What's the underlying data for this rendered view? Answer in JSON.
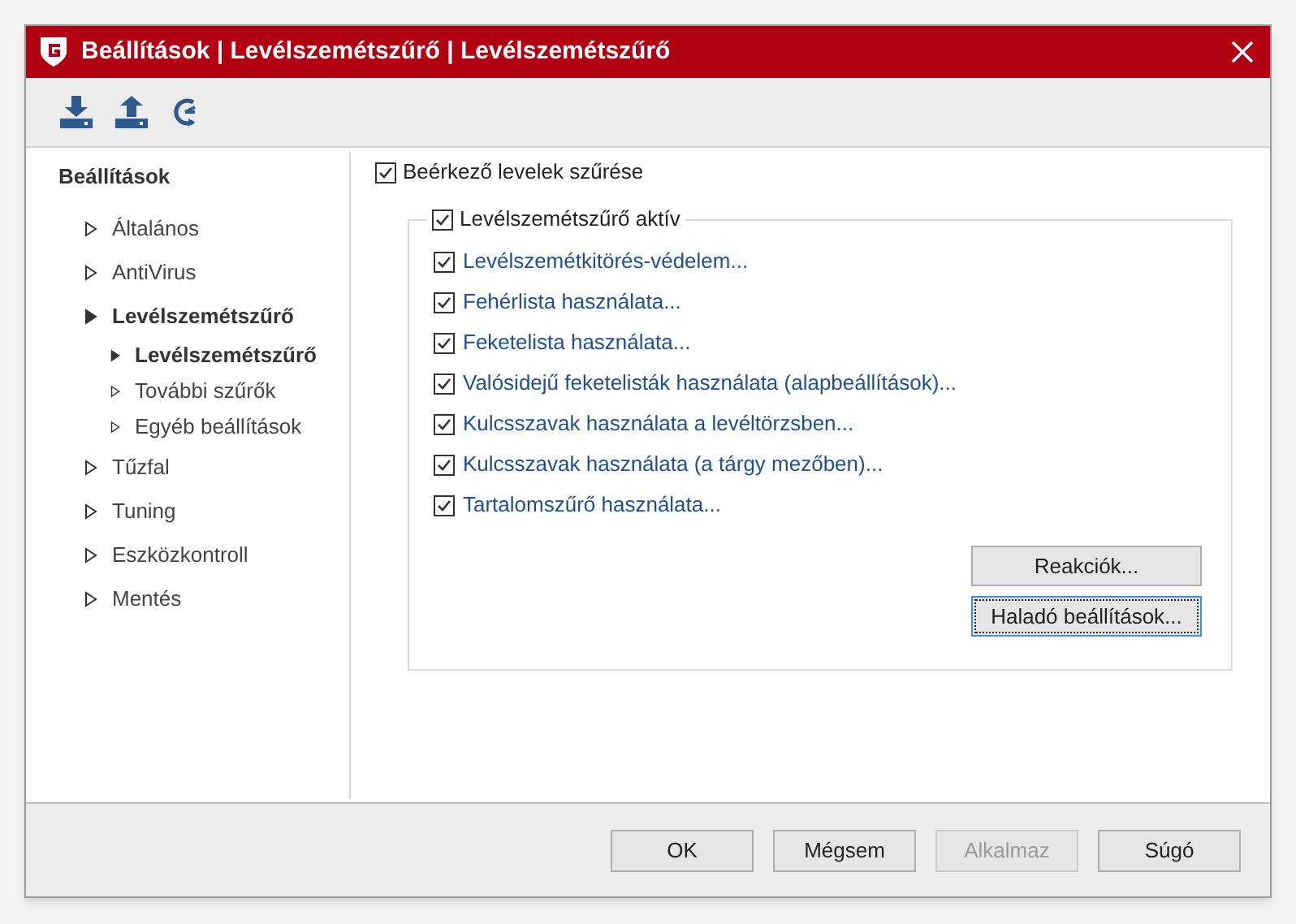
{
  "window": {
    "title": "Beállítások | Levélszemétszűrő | Levélszemétszűrő"
  },
  "sidebar": {
    "heading": "Beállítások",
    "items": [
      {
        "label": "Általános",
        "expanded": false
      },
      {
        "label": "AntiVirus",
        "expanded": false
      },
      {
        "label": "Levélszemétszűrő",
        "expanded": true,
        "children": [
          {
            "label": "Levélszemétszűrő",
            "selected": true
          },
          {
            "label": "További szűrők",
            "selected": false
          },
          {
            "label": "Egyéb beállítások",
            "selected": false
          }
        ]
      },
      {
        "label": "Tűzfal",
        "expanded": false
      },
      {
        "label": "Tuning",
        "expanded": false
      },
      {
        "label": "Eszközkontroll",
        "expanded": false
      },
      {
        "label": "Mentés",
        "expanded": false
      }
    ]
  },
  "incoming": {
    "label": "Beérkező levelek szűrése",
    "checked": true
  },
  "group": {
    "label": "Levélszemétszűrő aktív",
    "checked": true,
    "options": [
      {
        "label": "Levélszemétkitörés-védelem...",
        "checked": true
      },
      {
        "label": "Fehérlista használata...",
        "checked": true
      },
      {
        "label": "Feketelista használata...",
        "checked": true
      },
      {
        "label": "Valósidejű feketelisták használata (alapbeállítások)...",
        "checked": true
      },
      {
        "label": "Kulcsszavak használata a levéltörzsben...",
        "checked": true
      },
      {
        "label": "Kulcsszavak használata (a tárgy mezőben)...",
        "checked": true
      },
      {
        "label": "Tartalomszűrő használata...",
        "checked": true
      }
    ],
    "buttons": [
      {
        "label": "Reakciók...",
        "focused": false
      },
      {
        "label": "Haladó beállítások...",
        "focused": true
      }
    ]
  },
  "footer_buttons": [
    {
      "label": "OK",
      "disabled": false
    },
    {
      "label": "Mégsem",
      "disabled": false
    },
    {
      "label": "Alkalmaz",
      "disabled": true
    },
    {
      "label": "Súgó",
      "disabled": false
    }
  ]
}
